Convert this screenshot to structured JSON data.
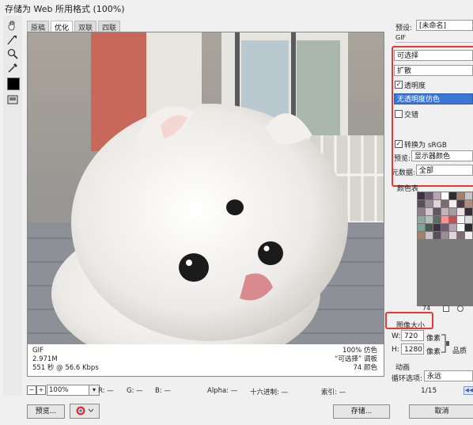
{
  "window": {
    "title": "存储为 Web 所用格式 (100%)"
  },
  "tabs": [
    {
      "label": "原稿",
      "active": false
    },
    {
      "label": "优化",
      "active": true
    },
    {
      "label": "双联",
      "active": false
    },
    {
      "label": "四联",
      "active": false
    }
  ],
  "info": {
    "format": "GIF",
    "size": "2.971M",
    "time": "551 秒 @ 56.6 Kbps",
    "dither": "100% 仿色",
    "palette_label": "“可选择” 调板",
    "colors": "74 颜色"
  },
  "status": {
    "zoom": "100%",
    "r": "R: —",
    "g": "G: —",
    "b": "B: —",
    "alpha": "Alpha: —",
    "hex": "十六进制: —",
    "index": "索引: —"
  },
  "buttons": {
    "preview": "预览...",
    "save": "存储...",
    "cancel": "取消"
  },
  "panel": {
    "preset_label": "预设:",
    "preset_value": "[未命名]",
    "format": "GIF",
    "palette": "可选择",
    "dither_algo": "扩散",
    "transparency_label": "透明度",
    "transparency_checked": true,
    "transparency_dither": "无透明度仿色",
    "interlaced_label": "交错",
    "interlaced_checked": false,
    "convert_label": "转换为 sRGB",
    "convert_checked": true,
    "preview_label": "预览:",
    "preview_value": "显示器颜色",
    "metadata_label": "元数据:",
    "metadata_value": "全部",
    "color_table_label": "颜色表",
    "color_count": "74",
    "image_size_label": "图像大小",
    "width_label": "W:",
    "width_value": "720",
    "height_label": "H:",
    "height_value": "1280",
    "unit": "像素",
    "quality_label": "品质",
    "animation_label": "动画",
    "loop_label": "循环选项:",
    "loop_value": "永远",
    "frame": "1/15"
  },
  "colors": {
    "highlight": "#3a76d6",
    "annotation": "#e53935"
  }
}
